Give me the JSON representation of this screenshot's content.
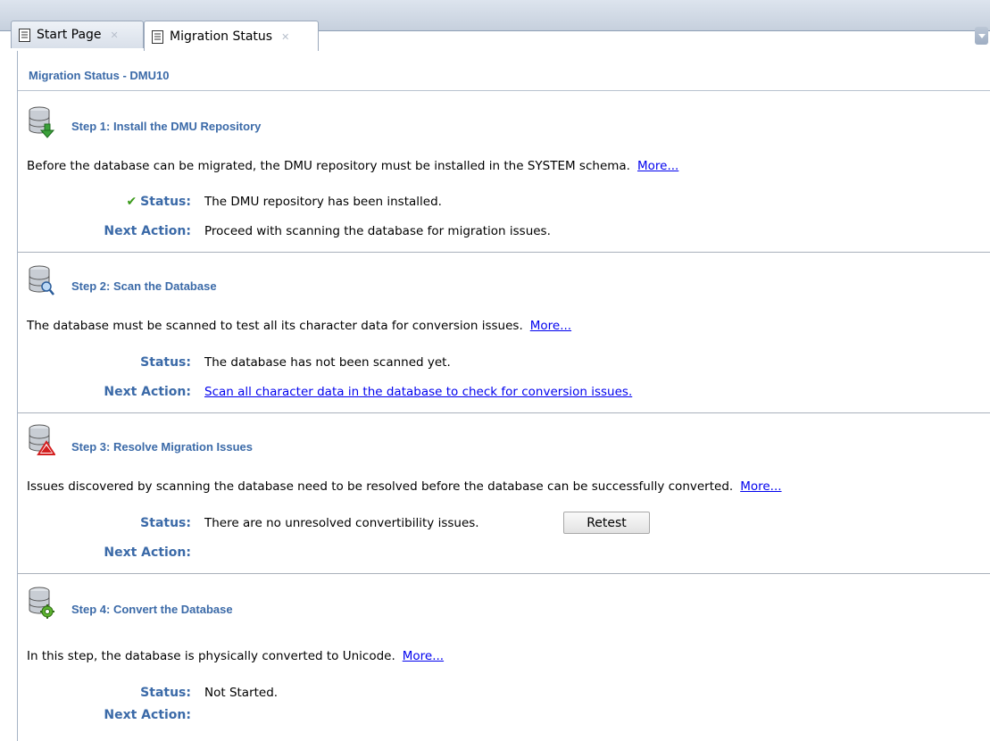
{
  "tabs": [
    {
      "label": "Start Page",
      "active": false
    },
    {
      "label": "Migration Status",
      "active": true
    }
  ],
  "page": {
    "title": "Migration Status - DMU10"
  },
  "steps": [
    {
      "title": "Step 1: Install the DMU Repository",
      "icon": "database-install-icon",
      "description": "Before the database can be migrated, the DMU repository must be installed in the SYSTEM schema.",
      "more": "More...",
      "status_label": "Status:",
      "status_value": "The DMU repository has been installed.",
      "status_ok": true,
      "next_label": "Next Action:",
      "next_value": "Proceed with scanning the database for migration issues."
    },
    {
      "title": "Step 2: Scan the Database",
      "icon": "database-scan-icon",
      "description": "The database must be scanned to test all its character data for conversion issues.",
      "more": "More...",
      "status_label": "Status:",
      "status_value": "The database has not been scanned yet.",
      "next_label": "Next Action:",
      "next_value": "Scan all character data in the database to check for conversion issues."
    },
    {
      "title": "Step 3: Resolve Migration Issues",
      "icon": "database-warning-icon",
      "description": "Issues discovered by scanning the database need to be resolved before the database can be successfully converted.",
      "more": "More...",
      "status_label": "Status:",
      "status_value": "There are no unresolved convertibility issues.",
      "button": "Retest",
      "next_label": "Next Action:",
      "next_value": ""
    },
    {
      "title": "Step 4: Convert the Database",
      "icon": "database-convert-icon",
      "description": "In this step, the database is physically converted to Unicode.",
      "more": "More...",
      "status_label": "Status:",
      "status_value": "Not Started.",
      "next_label": "Next Action:",
      "next_value": ""
    }
  ],
  "colors": {
    "accent": "#3b6aa8",
    "link": "#0000ee",
    "ok": "#3a9a1a",
    "warning": "#d42020"
  }
}
